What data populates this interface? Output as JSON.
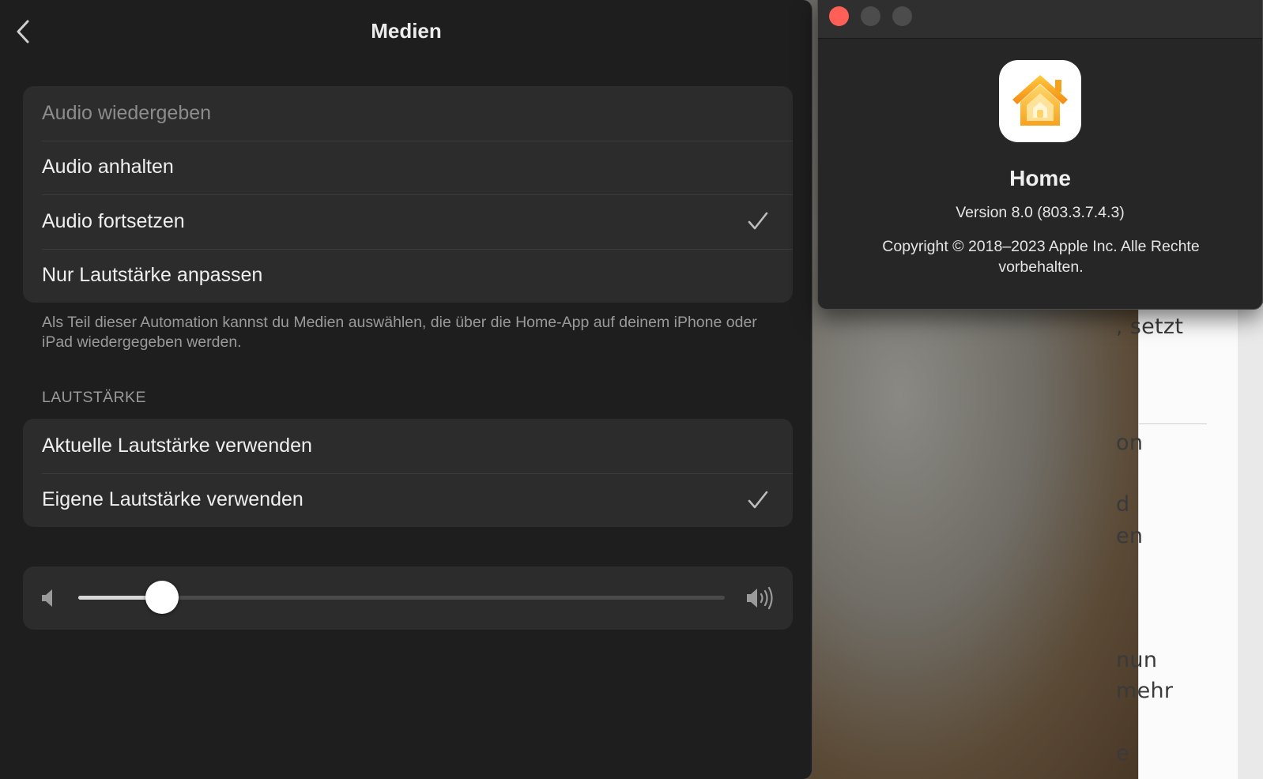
{
  "main_window": {
    "title": "Medien",
    "media_options": [
      {
        "label": "Audio wiedergeben",
        "selected": false,
        "dimmed": true
      },
      {
        "label": "Audio anhalten",
        "selected": false,
        "dimmed": false
      },
      {
        "label": "Audio fortsetzen",
        "selected": true,
        "dimmed": false
      },
      {
        "label": "Nur Lautstärke anpassen",
        "selected": false,
        "dimmed": false
      }
    ],
    "footnote": "Als Teil dieser Automation kannst du Medien auswählen, die über die Home-App auf deinem iPhone oder iPad wiedergegeben werden.",
    "volume_section": {
      "header": "LAUTSTÄRKE",
      "options": [
        {
          "label": "Aktuelle Lautstärke verwenden",
          "selected": false
        },
        {
          "label": "Eigene Lautstärke verwenden",
          "selected": true
        }
      ],
      "slider_level": 0.13
    }
  },
  "about_window": {
    "app_name": "Home",
    "version": "Version 8.0 (803.3.7.4.3)",
    "copyright": "Copyright © 2018–2023 Apple Inc. Alle Rechte vorbehalten."
  },
  "background_document": {
    "fragments": [
      ", setzt",
      "on",
      "d",
      "en",
      "nun",
      "mehr",
      "e"
    ]
  },
  "colors": {
    "window_bg": "#1e1e1e",
    "group_bg": "#2c2c2c",
    "close_button": "#fe5f57",
    "home_icon_orange": "#f7a21c"
  },
  "icons": {
    "back": "chevron-left-icon",
    "check": "checkmark-icon",
    "volume_low": "speaker-icon",
    "volume_high": "speaker-wave-icon",
    "app": "home-app-icon"
  }
}
